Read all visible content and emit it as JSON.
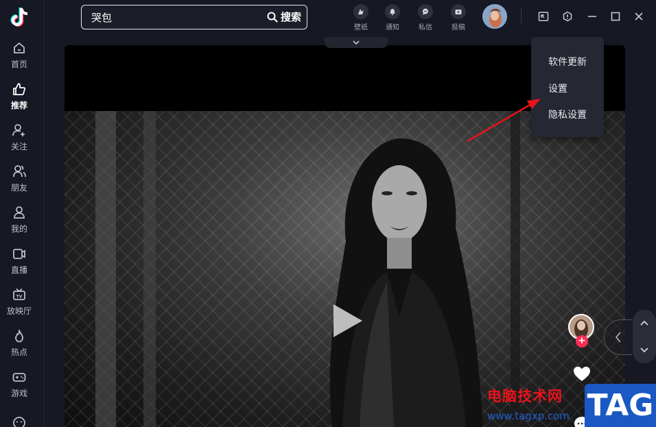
{
  "sidebar": {
    "items": [
      {
        "label": "首页",
        "icon": "home-icon"
      },
      {
        "label": "推荐",
        "icon": "thumbs-up-icon",
        "active": true
      },
      {
        "label": "关注",
        "icon": "follow-user-icon"
      },
      {
        "label": "朋友",
        "icon": "friends-icon"
      },
      {
        "label": "我的",
        "icon": "profile-icon"
      },
      {
        "label": "直播",
        "icon": "live-icon"
      },
      {
        "label": "放映厅",
        "icon": "tv-icon"
      },
      {
        "label": "热点",
        "icon": "fire-icon"
      },
      {
        "label": "游戏",
        "icon": "gamepad-icon"
      }
    ]
  },
  "search": {
    "value": "哭包",
    "button_label": "搜索"
  },
  "header": {
    "icons": [
      {
        "label": "壁纸",
        "icon": "wallpaper-icon"
      },
      {
        "label": "通知",
        "icon": "bell-icon"
      },
      {
        "label": "私信",
        "icon": "message-icon"
      },
      {
        "label": "投稿",
        "icon": "upload-icon"
      }
    ]
  },
  "menu": {
    "items": [
      "软件更新",
      "设置",
      "隐私设置"
    ]
  },
  "colors": {
    "background": "#161823",
    "accent": "#fe2c55",
    "annotation_arrow": "#e8141c",
    "watermark_blue": "#1a58c4"
  },
  "watermark": {
    "title": "电脑技术网",
    "url": "www.tagxp.com",
    "tag": "TAG"
  }
}
